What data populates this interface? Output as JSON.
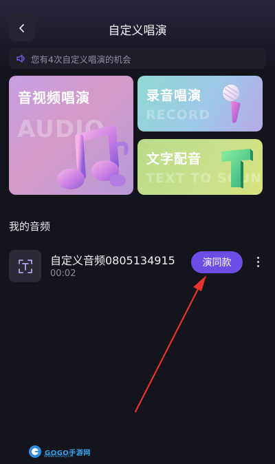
{
  "header": {
    "title": "自定义唱演",
    "back_icon": "chevron-left-icon"
  },
  "notice": {
    "icon": "speaker-icon",
    "text": "您有4次自定义唱演的机会",
    "icon_color": "#7b5cf0"
  },
  "cards": {
    "audio_video": {
      "title": "音视频唱演",
      "subtitle": "AUDIO",
      "decoration": "music-note-icon"
    },
    "record": {
      "title": "录音唱演",
      "subtitle": "RECORD",
      "decoration": "microphone-icon"
    },
    "text_to_sound": {
      "title": "文字配音",
      "subtitle": "TEXT TO SOUND",
      "decoration": "letter-t-icon"
    }
  },
  "my_audio": {
    "section_title": "我的音频",
    "items": [
      {
        "name": "自定义音频0805134915",
        "duration": "00:02",
        "thumb_icon": "text-scan-icon",
        "action_label": "演同款",
        "more_icon": "more-vertical-icon"
      }
    ]
  },
  "annotation": {
    "arrow_color": "#e8322e"
  },
  "watermark": {
    "brand": "GOGO手游网",
    "url": "WWW.GOGOJ.CN"
  },
  "colors": {
    "background": "#14141c",
    "accent": "#6c4de6"
  }
}
